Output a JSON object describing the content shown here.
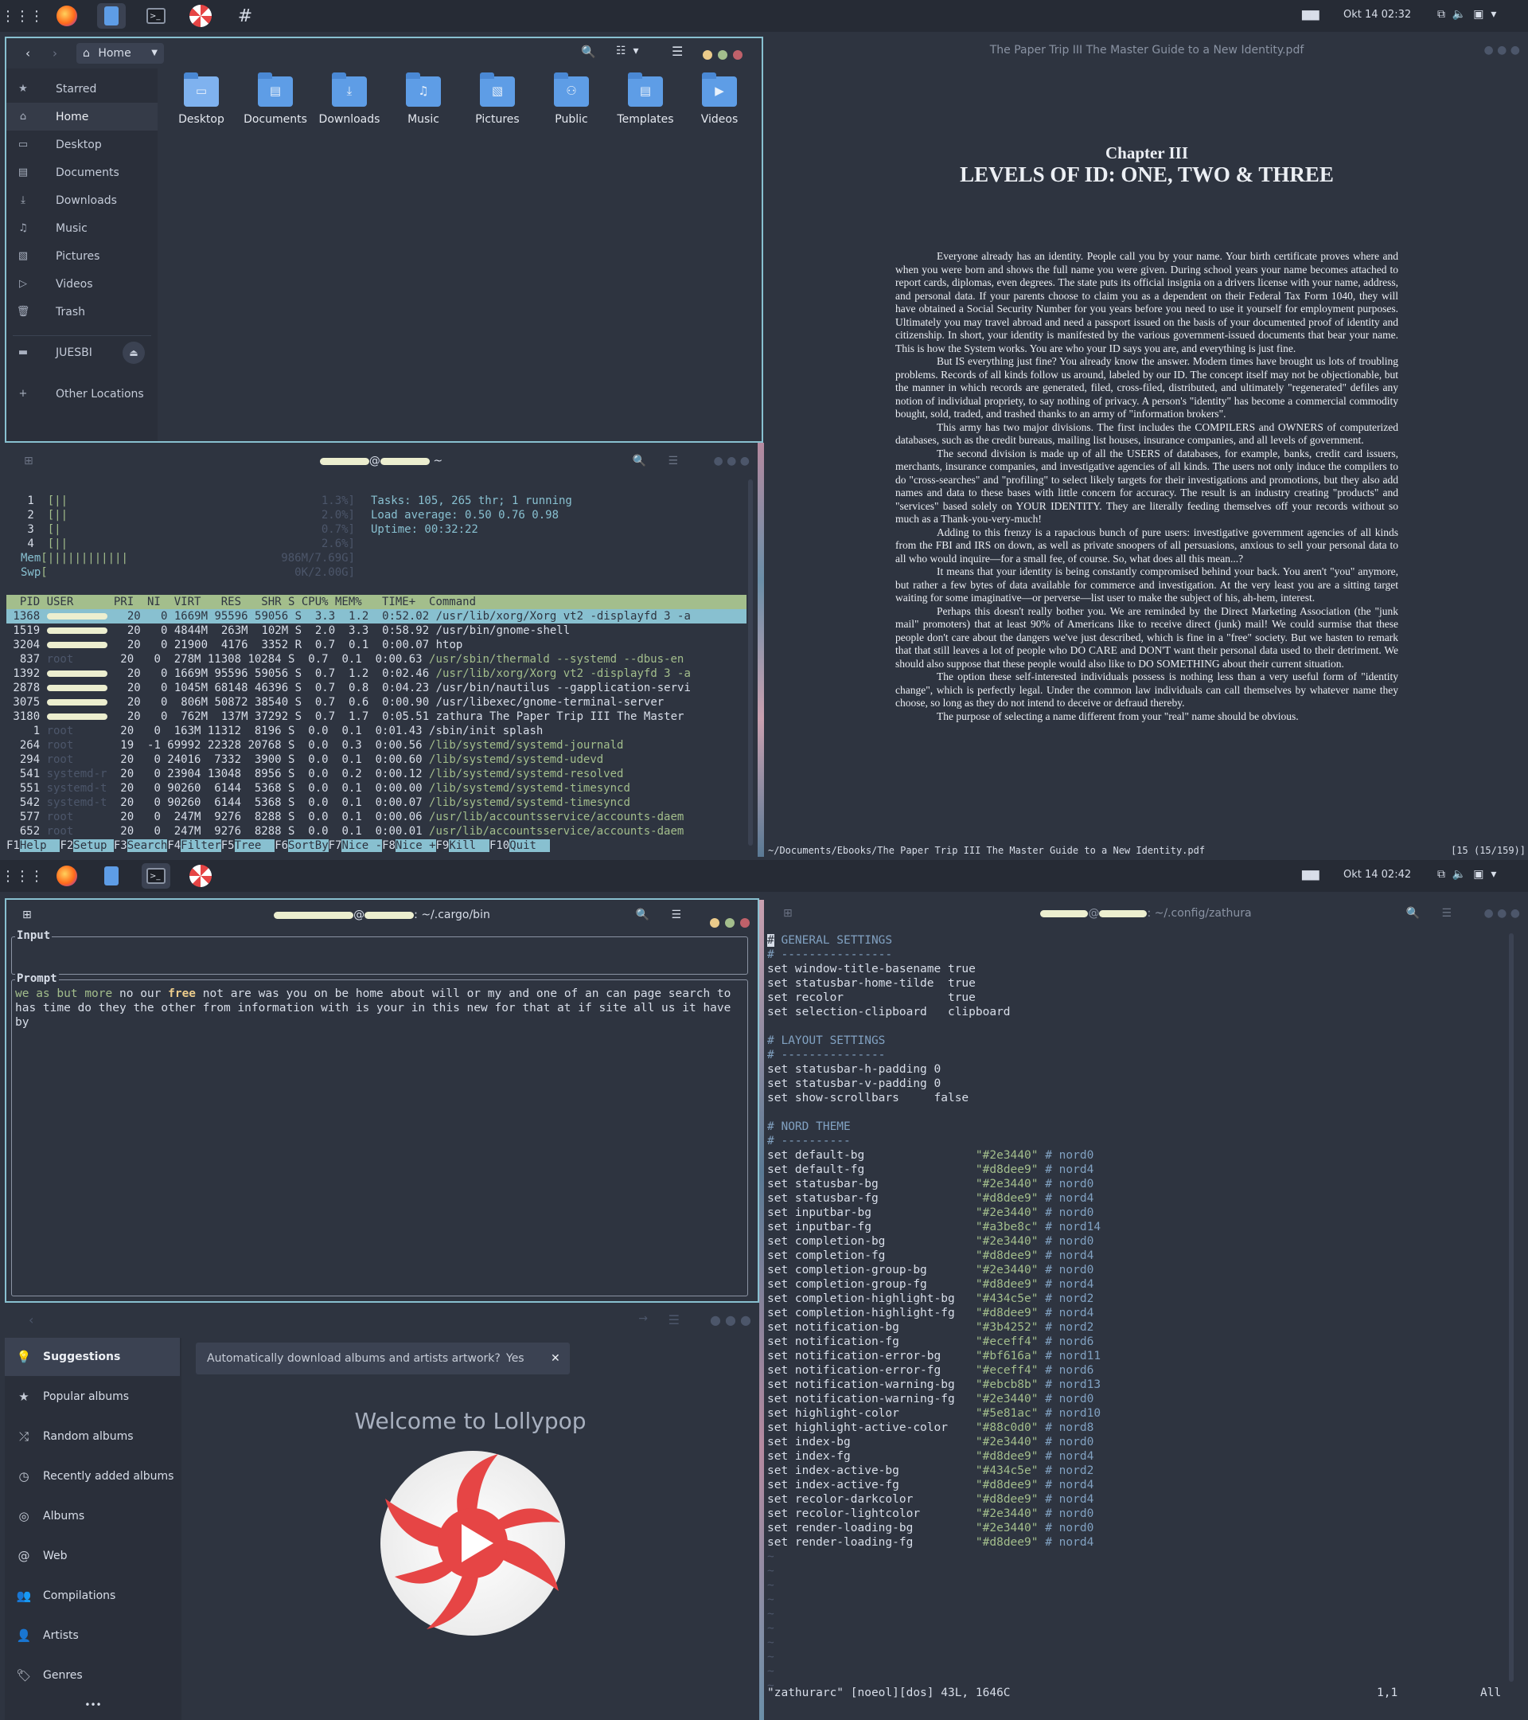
{
  "topbar1": {
    "clock": "Okt 14  02:32"
  },
  "topbar2": {
    "clock": "Okt 14  02:42"
  },
  "nautilus": {
    "location": "Home",
    "sidebar": [
      {
        "label": "Starred",
        "icon": "star-icon"
      },
      {
        "label": "Home",
        "icon": "home-icon"
      },
      {
        "label": "Desktop",
        "icon": "desktop-icon"
      },
      {
        "label": "Documents",
        "icon": "documents-icon"
      },
      {
        "label": "Downloads",
        "icon": "downloads-icon"
      },
      {
        "label": "Music",
        "icon": "music-icon"
      },
      {
        "label": "Pictures",
        "icon": "pictures-icon"
      },
      {
        "label": "Videos",
        "icon": "videos-icon"
      },
      {
        "label": "Trash",
        "icon": "trash-icon"
      },
      {
        "label": "JUESBI",
        "icon": "drive-icon"
      },
      {
        "label": "Other Locations",
        "icon": "plus-icon"
      }
    ],
    "folders": [
      "Desktop",
      "Documents",
      "Downloads",
      "Music",
      "Pictures",
      "Public",
      "Templates",
      "Videos"
    ]
  },
  "htop": {
    "title_suffix": "@",
    "title_path": "~",
    "cpu": [
      {
        "n": "1",
        "bar": "[||",
        "pct": "1.3%]"
      },
      {
        "n": "2",
        "bar": "[||",
        "pct": "2.0%]"
      },
      {
        "n": "3",
        "bar": "[|",
        "pct": "0.7%]"
      },
      {
        "n": "4",
        "bar": "[||",
        "pct": "2.6%]"
      }
    ],
    "mem": {
      "label": "Mem",
      "bar": "[||||||||||||",
      "val": "986M/7.69G]"
    },
    "swp": {
      "label": "Swp",
      "bar": "[",
      "val": "0K/2.00G]"
    },
    "tasks": "Tasks: 105, 265 thr; 1 running",
    "load": "Load average: 0.50 0.76 0.98",
    "uptime": "Uptime: 00:32:22",
    "header": "  PID USER      PRI  NI  VIRT   RES   SHR S CPU% MEM%   TIME+  Command",
    "rows": [
      {
        "pid": "1368",
        "user": "",
        "pri": "20",
        "ni": "0",
        "virt": "1669M",
        "res": "95596",
        "shr": "59056",
        "s": "S",
        "cpu": "3.3",
        "mem": "1.2",
        "time": "0:52.02",
        "cmd": "/usr/lib/xorg/Xorg vt2 -displayfd 3 -a"
      },
      {
        "pid": "1519",
        "user": "",
        "pri": "20",
        "ni": "0",
        "virt": "4844M",
        "res": "263M",
        "shr": "102M",
        "s": "S",
        "cpu": "2.0",
        "mem": "3.3",
        "time": "0:58.92",
        "cmd": "/usr/bin/gnome-shell"
      },
      {
        "pid": "3204",
        "user": "",
        "pri": "20",
        "ni": "0",
        "virt": "21900",
        "res": "4176",
        "shr": "3352",
        "s": "R",
        "cpu": "0.7",
        "mem": "0.1",
        "time": "0:00.07",
        "cmd": "htop"
      },
      {
        "pid": "837",
        "user": "root",
        "pri": "20",
        "ni": "0",
        "virt": "278M",
        "res": "11308",
        "shr": "10284",
        "s": "S",
        "cpu": "0.7",
        "mem": "0.1",
        "time": "0:00.63",
        "cmd": "/usr/sbin/thermald --systemd --dbus-en"
      },
      {
        "pid": "1392",
        "user": "",
        "pri": "20",
        "ni": "0",
        "virt": "1669M",
        "res": "95596",
        "shr": "59056",
        "s": "S",
        "cpu": "0.7",
        "mem": "1.2",
        "time": "0:02.46",
        "cmd": "/usr/lib/xorg/Xorg vt2 -displayfd 3 -a"
      },
      {
        "pid": "2878",
        "user": "",
        "pri": "20",
        "ni": "0",
        "virt": "1045M",
        "res": "68148",
        "shr": "46396",
        "s": "S",
        "cpu": "0.7",
        "mem": "0.8",
        "time": "0:04.23",
        "cmd": "/usr/bin/nautilus --gapplication-servi"
      },
      {
        "pid": "3075",
        "user": "",
        "pri": "20",
        "ni": "0",
        "virt": "806M",
        "res": "50872",
        "shr": "38540",
        "s": "S",
        "cpu": "0.7",
        "mem": "0.6",
        "time": "0:00.90",
        "cmd": "/usr/libexec/gnome-terminal-server"
      },
      {
        "pid": "3180",
        "user": "",
        "pri": "20",
        "ni": "0",
        "virt": "762M",
        "res": "137M",
        "shr": "37292",
        "s": "S",
        "cpu": "0.7",
        "mem": "1.7",
        "time": "0:05.51",
        "cmd": "zathura The Paper Trip III The Master"
      },
      {
        "pid": "1",
        "user": "root",
        "pri": "20",
        "ni": "0",
        "virt": "163M",
        "res": "11312",
        "shr": "8196",
        "s": "S",
        "cpu": "0.0",
        "mem": "0.1",
        "time": "0:01.43",
        "cmd": "/sbin/init splash"
      },
      {
        "pid": "264",
        "user": "root",
        "pri": "19",
        "ni": "-1",
        "virt": "69992",
        "res": "22328",
        "shr": "20768",
        "s": "S",
        "cpu": "0.0",
        "mem": "0.3",
        "time": "0:00.56",
        "cmd": "/lib/systemd/systemd-journald"
      },
      {
        "pid": "294",
        "user": "root",
        "pri": "20",
        "ni": "0",
        "virt": "24016",
        "res": "7332",
        "shr": "3900",
        "s": "S",
        "cpu": "0.0",
        "mem": "0.1",
        "time": "0:00.60",
        "cmd": "/lib/systemd/systemd-udevd"
      },
      {
        "pid": "541",
        "user": "systemd-r",
        "pri": "20",
        "ni": "0",
        "virt": "23904",
        "res": "13048",
        "shr": "8956",
        "s": "S",
        "cpu": "0.0",
        "mem": "0.2",
        "time": "0:00.12",
        "cmd": "/lib/systemd/systemd-resolved"
      },
      {
        "pid": "551",
        "user": "systemd-t",
        "pri": "20",
        "ni": "0",
        "virt": "90260",
        "res": "6144",
        "shr": "5368",
        "s": "S",
        "cpu": "0.0",
        "mem": "0.1",
        "time": "0:00.00",
        "cmd": "/lib/systemd/systemd-timesyncd"
      },
      {
        "pid": "542",
        "user": "systemd-t",
        "pri": "20",
        "ni": "0",
        "virt": "90260",
        "res": "6144",
        "shr": "5368",
        "s": "S",
        "cpu": "0.0",
        "mem": "0.1",
        "time": "0:00.07",
        "cmd": "/lib/systemd/systemd-timesyncd"
      },
      {
        "pid": "577",
        "user": "root",
        "pri": "20",
        "ni": "0",
        "virt": "247M",
        "res": "9276",
        "shr": "8288",
        "s": "S",
        "cpu": "0.0",
        "mem": "0.1",
        "time": "0:00.06",
        "cmd": "/usr/lib/accountsservice/accounts-daem"
      },
      {
        "pid": "652",
        "user": "root",
        "pri": "20",
        "ni": "0",
        "virt": "247M",
        "res": "9276",
        "shr": "8288",
        "s": "S",
        "cpu": "0.0",
        "mem": "0.1",
        "time": "0:00.01",
        "cmd": "/usr/lib/accountsservice/accounts-daem"
      }
    ],
    "fkeys": [
      {
        "k": "F1",
        "l": "Help"
      },
      {
        "k": "F2",
        "l": "Setup"
      },
      {
        "k": "F3",
        "l": "Search"
      },
      {
        "k": "F4",
        "l": "Filter"
      },
      {
        "k": "F5",
        "l": "Tree"
      },
      {
        "k": "F6",
        "l": "SortBy"
      },
      {
        "k": "F7",
        "l": "Nice -"
      },
      {
        "k": "F8",
        "l": "Nice +"
      },
      {
        "k": "F9",
        "l": "Kill"
      },
      {
        "k": "F10",
        "l": "Quit"
      }
    ]
  },
  "pdf": {
    "window_title": "The Paper Trip III The Master Guide to a New Identity.pdf",
    "chapter": "Chapter III",
    "heading": "LEVELS OF ID: ONE, TWO & THREE",
    "paragraphs": [
      "Everyone already has an identity.  People call you by your name.  Your birth certificate proves where and when you were born and shows the full name you were given.  During school years your name becomes attached to report cards, diplomas, even degrees.  The state puts its official insignia on a drivers license with your name, address, and personal data.  If your parents choose to claim you as a dependent on their Federal Tax Form 1040, they will have obtained a Social Security Number for you years before you need to use it yourself for employment purposes.  Ultimately you may travel abroad and need a passport issued on the basis of your documented proof of identity and citizenship.  In short, your identity is manifested by the various government-issued documents that bear your name.  This is how the System works.  You are who your ID says you are, and everything is just fine.",
      "But IS everything just fine?  You already know the answer.  Modern times have brought us lots of troubling problems.  Records of all kinds follow us around, labeled by our ID.  The concept itself may not be objectionable, but the manner in which records are generated, filed, cross-filed, distributed, and ultimately \"regenerated\" defiles any notion of individual propriety, to say nothing of privacy.  A person's \"identity\" has become a commercial commodity bought, sold, traded, and trashed thanks to an army of \"information brokers\".",
      "This army has two major divisions.  The first includes the COMPILERS and OWNERS of computerized databases, such as the credit bureaus, mailing list houses, insurance companies, and all levels of government.",
      "The second division is made up of all the USERS of databases, for example, banks, credit card issuers, merchants, insurance companies, and investigative agencies of all kinds. The users not only induce the compilers to do \"cross-searches\" and \"profiling\" to select likely targets for their investigations and promotions, but they also add names and data to these bases with little concern for accuracy.  The result is an industry creating \"products\" and \"services\" based solely on YOUR IDENTITY.  They are literally feeding themselves off your records without so much as a Thank-you-very-much!",
      "Adding to this frenzy is a rapacious bunch of pure users: investigative government agencies of all kinds from the FBI and IRS on down, as well as private snoopers of all persuasions, anxious to sell your personal data to all who would inquire—for a small fee, of course.  So, what does all this mean...?",
      "It means that your identity is being constantly compromised behind your back.  You aren't \"you\" anymore, but rather a few bytes of data available for commerce and investigation. At the very least you are a sitting target waiting for some imaginative—or perverse—list user to make the subject of his, ah-hem, interest.",
      "Perhaps this doesn't really bother you.  We are reminded by the Direct Marketing Association (the \"junk mail\" promoters) that at least 90% of Americans like to receive direct (junk) mail!  We could surmise that these people don't care about the dangers we've just described, which is fine in a \"free\" society.  But we hasten to remark that that still leaves a lot of people who DO CARE and DON'T want their personal data used to their detriment.  We should also suppose that these people would also like to DO SOMETHING about their current situation.",
      "The option these self-interested individuals possess is nothing less than a very useful form of \"identity change\", which is perfectly legal.  Under the common law individuals can call themselves by whatever name they choose, so long as they do not intend to deceive or defraud thereby.",
      "The purpose of selecting a name different from your \"real\" name should be obvious."
    ],
    "status_path": "~/Documents/Ebooks/The Paper Trip III The Master Guide to a New Identity.pdf",
    "status_page": "[15 (15/159)]"
  },
  "cargo_term": {
    "title_path": ": ~/.cargo/bin",
    "input_label": "Input",
    "prompt_label": "Prompt",
    "prompt_text": "we as but more no our free not are was you on be home about will or my and one of an can page search to has time do they the other from information with is your in this new for that at if site all us it have by"
  },
  "zathura_cfg": {
    "title_path": ": ~/.config/zathura",
    "lines": [
      "# GENERAL SETTINGS",
      "# ----------------",
      "set window-title-basename true",
      "set statusbar-home-tilde  true",
      "set recolor               true",
      "set selection-clipboard   clipboard",
      "",
      "# LAYOUT SETTINGS",
      "# ---------------",
      "set statusbar-h-padding 0",
      "set statusbar-v-padding 0",
      "set show-scrollbars     false",
      "",
      "# NORD THEME",
      "# ----------",
      "set default-bg                \"#2e3440\" # nord0",
      "set default-fg                \"#d8dee9\" # nord4",
      "set statusbar-bg              \"#2e3440\" # nord0",
      "set statusbar-fg              \"#d8dee9\" # nord4",
      "set inputbar-bg               \"#2e3440\" # nord0",
      "set inputbar-fg               \"#a3be8c\" # nord14",
      "set completion-bg             \"#2e3440\" # nord0",
      "set completion-fg             \"#d8dee9\" # nord4",
      "set completion-group-bg       \"#2e3440\" # nord0",
      "set completion-group-fg       \"#d8dee9\" # nord4",
      "set completion-highlight-bg   \"#434c5e\" # nord2",
      "set completion-highlight-fg   \"#d8dee9\" # nord4",
      "set notification-bg           \"#3b4252\" # nord2",
      "set notification-fg           \"#eceff4\" # nord6",
      "set notification-error-bg     \"#bf616a\" # nord11",
      "set notification-error-fg     \"#eceff4\" # nord6",
      "set notification-warning-bg   \"#ebcb8b\" # nord13",
      "set notification-warning-fg   \"#2e3440\" # nord0",
      "set highlight-color           \"#5e81ac\" # nord10",
      "set highlight-active-color    \"#88c0d0\" # nord8",
      "set index-bg                  \"#2e3440\" # nord0",
      "set index-fg                  \"#d8dee9\" # nord4",
      "set index-active-bg           \"#434c5e\" # nord2",
      "set index-active-fg           \"#d8dee9\" # nord4",
      "set recolor-darkcolor         \"#d8dee9\" # nord4",
      "set recolor-lightcolor        \"#2e3440\" # nord0",
      "set render-loading-bg         \"#2e3440\" # nord0",
      "set render-loading-fg         \"#d8dee9\" # nord4"
    ],
    "tilde_count": 10,
    "status_left": "\"zathurarc\" [noeol][dos] 43L, 1646C",
    "status_pos": "1,1",
    "status_all": "All"
  },
  "lollypop": {
    "notice": "Automatically download albums and artists artwork?",
    "notice_yes": "Yes",
    "welcome": "Welcome to Lollypop",
    "sidebar": [
      {
        "label": "Suggestions",
        "icon": "lightbulb-icon"
      },
      {
        "label": "Popular albums",
        "icon": "star-icon"
      },
      {
        "label": "Random albums",
        "icon": "shuffle-icon"
      },
      {
        "label": "Recently added albums",
        "icon": "clock-icon"
      },
      {
        "label": "Albums",
        "icon": "disc-icon"
      },
      {
        "label": "Web",
        "icon": "at-icon"
      },
      {
        "label": "Compilations",
        "icon": "group-icon"
      },
      {
        "label": "Artists",
        "icon": "person-icon"
      },
      {
        "label": "Genres",
        "icon": "tag-icon"
      }
    ],
    "more": "•••"
  },
  "colors": {
    "nord0": "#2e3440",
    "nord8": "#88c0d0",
    "accent_red": "#e64545"
  }
}
